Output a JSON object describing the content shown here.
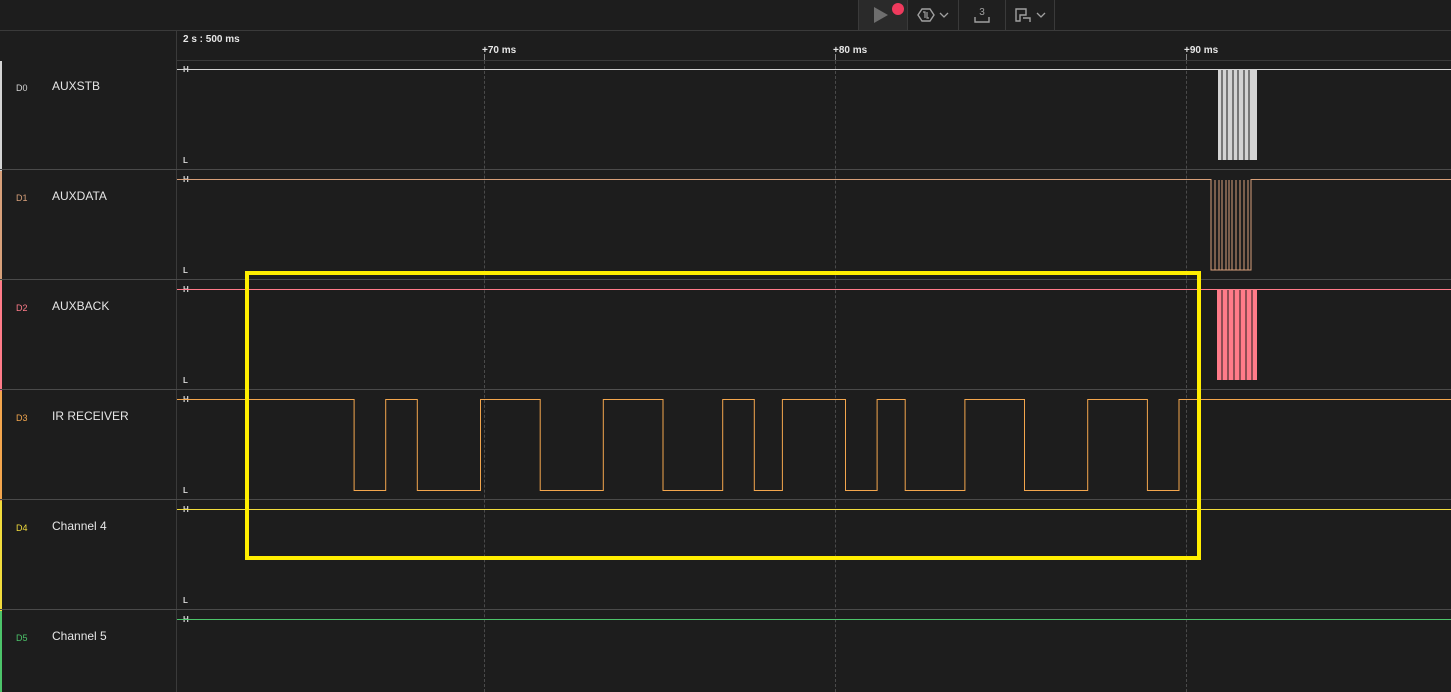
{
  "toolbar": {
    "play_icon": "play-icon",
    "record_icon": "record-dot-icon",
    "trigger_icon": "trigger-settings-icon",
    "trigger_dropdown_icon": "chevron-down-icon",
    "measure_icon": "measure-icon",
    "measure_badge": "3",
    "extension_icon": "extension-icon",
    "extension_dropdown_icon": "chevron-down-icon",
    "record_color": "#ef3a5d"
  },
  "timeline": {
    "start_label": "2 s : 500 ms",
    "ticks": [
      {
        "label": "+70 ms",
        "ms": 70
      },
      {
        "label": "+80 ms",
        "ms": 80
      },
      {
        "label": "+90 ms",
        "ms": 90
      }
    ]
  },
  "level_labels": {
    "high": "H",
    "low": "L"
  },
  "channels": [
    {
      "id": "D0",
      "name": "AUXSTB",
      "color": "#d4d4d4"
    },
    {
      "id": "D1",
      "name": "AUXDATA",
      "color": "#d8a07a"
    },
    {
      "id": "D2",
      "name": "AUXBACK",
      "color": "#ff7b89"
    },
    {
      "id": "D3",
      "name": "IR RECEIVER",
      "color": "#f3a64d"
    },
    {
      "id": "D4",
      "name": "Channel 4",
      "color": "#f2dc3c"
    },
    {
      "id": "D5",
      "name": "Channel 5",
      "color": "#4cc46a"
    }
  ],
  "highlight": {
    "color": "#ffee00"
  },
  "signals": {
    "ir_receiver": {
      "low_pulses_ms": [
        [
          66.3,
          67.2
        ],
        [
          68.1,
          69.9
        ],
        [
          71.6,
          73.4
        ],
        [
          75.1,
          76.8
        ],
        [
          77.7,
          78.5
        ],
        [
          80.3,
          81.2
        ],
        [
          82.0,
          83.7
        ],
        [
          85.4,
          87.2
        ],
        [
          88.9,
          89.8
        ]
      ]
    }
  }
}
